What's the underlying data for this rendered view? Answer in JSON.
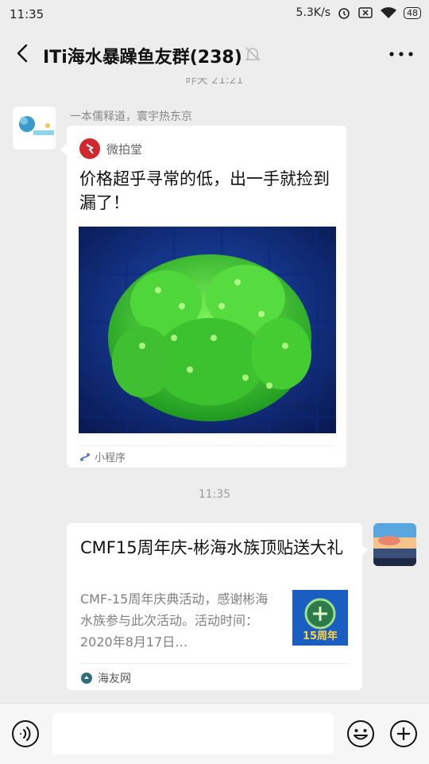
{
  "status_bar": {
    "time": "11:35",
    "network_speed": "5.3K/s",
    "battery": "48"
  },
  "header": {
    "title": "ITi海水暴躁鱼友群(238)"
  },
  "messages": [
    {
      "time_divider": "昨天 21:21",
      "sender_name": "一本儒释道，寰宇热东京",
      "card": {
        "source": "微拍堂",
        "headline": "价格超乎寻常的低，出一手就捡到漏了！",
        "footer": "小程序"
      }
    },
    {
      "time_divider": "11:35",
      "card": {
        "headline": "CMF15周年庆-彬海水族顶贴送大礼",
        "description": "CMF-15周年庆典活动，感谢彬海水族参与此次活动。活动时间：2020年8月17日…",
        "thumbnail_text": "15周年",
        "footer": "海友网"
      }
    }
  ],
  "icons": {
    "back": "chevron-left-icon",
    "mute": "bell-off-icon",
    "more": "ellipsis-icon",
    "voice": "voice-icon",
    "emoji": "smiley-icon",
    "plus": "plus-circle-icon"
  },
  "colors": {
    "background": "#ededed",
    "bubble": "#ffffff",
    "brand_red": "#d0282e"
  }
}
